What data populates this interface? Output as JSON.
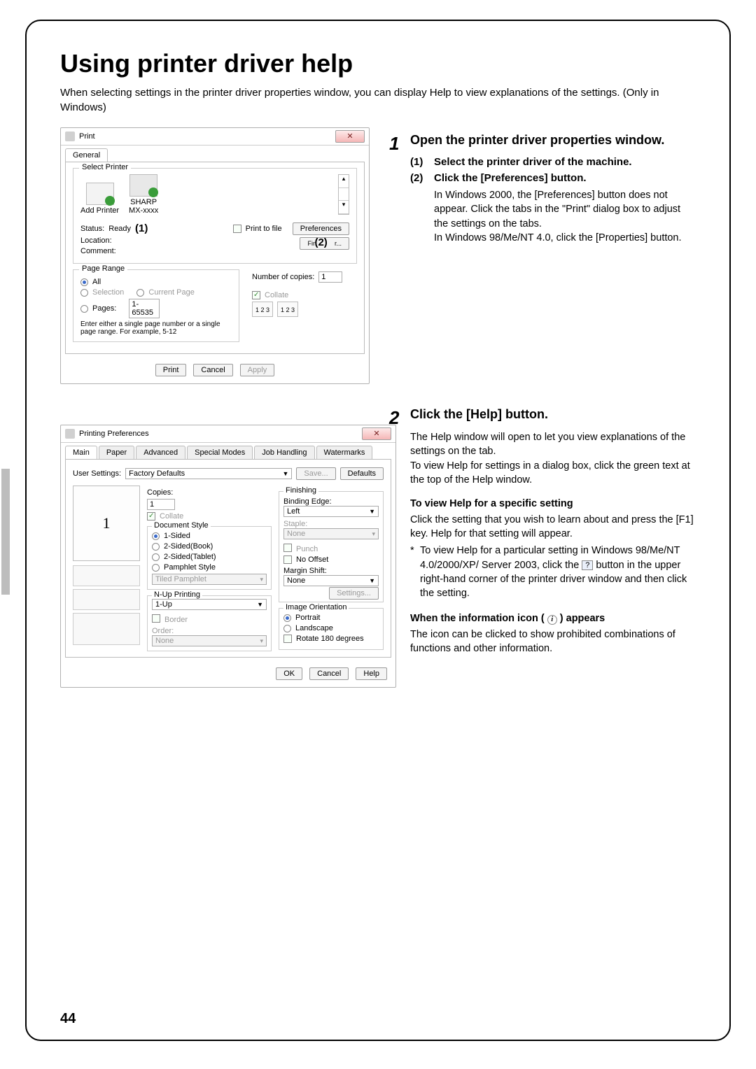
{
  "page": {
    "title": "Using printer driver help",
    "intro": "When selecting settings in the printer driver properties window, you can display Help to view explanations of the settings. (Only in Windows)",
    "page_number": "44"
  },
  "step1": {
    "num": "1",
    "heading": "Open the printer driver properties window.",
    "sub1_n": "(1)",
    "sub1_t": "Select the printer driver of the machine.",
    "sub2_n": "(2)",
    "sub2_t": "Click the [Preferences] button.",
    "detail": "In Windows 2000, the [Preferences] button does not appear. Click the tabs in the \"Print\" dialog box to adjust the settings on the tabs.\nIn Windows 98/Me/NT 4.0, click the [Properties] button."
  },
  "step2": {
    "num": "2",
    "heading": "Click the [Help] button.",
    "para1": "The Help window will open to let you view explanations of the settings on the tab.\nTo view Help for settings in a dialog box, click the green text at the top of the Help window.",
    "sub_heading": "To view Help for a specific setting",
    "para2": "Click the setting that you wish to learn about and press the [F1] key. Help for that setting will appear.",
    "bullet_mk": "*",
    "bullet_a": "To view Help for a particular setting in Windows 98/Me/NT 4.0/2000/XP/ Server 2003, click the ",
    "bullet_b": " button in the upper right-hand corner of the printer driver window and then click the setting.",
    "info_heading_a": "When the information icon ( ",
    "info_heading_b": " ) appears",
    "para3": "The icon can be clicked to show prohibited combinations of functions and other information."
  },
  "print_dialog": {
    "title": "Print",
    "tab": "General",
    "select_printer": "Select Printer",
    "add_printer": "Add Printer",
    "sharp": "SHARP",
    "model": "MX-xxxx",
    "status_lbl": "Status:",
    "status_val": "Ready",
    "callout1": "(1)",
    "location": "Location:",
    "comment": "Comment:",
    "print_to_file": "Print to file",
    "preferences": "Preferences",
    "find": "Find Printer...",
    "callout2": "(2)",
    "page_range": "Page Range",
    "all": "All",
    "selection": "Selection",
    "current": "Current Page",
    "pages": "Pages:",
    "pages_val": "1-65535",
    "hint": "Enter either a single page number or a single page range. For example, 5-12",
    "copies_lbl": "Number of copies:",
    "copies_val": "1",
    "collate": "Collate",
    "c123a": "1 2 3",
    "c123b": "1 2 3",
    "print": "Print",
    "cancel": "Cancel",
    "apply": "Apply"
  },
  "prefs": {
    "title": "Printing Preferences",
    "tabs": {
      "main": "Main",
      "paper": "Paper",
      "advanced": "Advanced",
      "special": "Special Modes",
      "job": "Job Handling",
      "water": "Watermarks"
    },
    "user_settings": "User Settings:",
    "factory_defaults": "Factory Defaults",
    "save": "Save...",
    "defaults": "Defaults",
    "preview_num": "1",
    "copies_lbl": "Copies:",
    "copies_val": "1",
    "collate": "Collate",
    "doc_style": "Document Style",
    "s1": "1-Sided",
    "s2": "2-Sided(Book)",
    "s3": "2-Sided(Tablet)",
    "s4": "Pamphlet Style",
    "tiled": "Tiled Pamphlet",
    "nup": "N-Up Printing",
    "nup_val": "1-Up",
    "border": "Border",
    "order_lbl": "Order:",
    "order_val": "None",
    "finishing": "Finishing",
    "binding_lbl": "Binding Edge:",
    "binding_val": "Left",
    "staple_lbl": "Staple:",
    "staple_val": "None",
    "punch": "Punch",
    "nooffset": "No Offset",
    "margin_lbl": "Margin Shift:",
    "margin_val": "None",
    "settings": "Settings...",
    "orient": "Image Orientation",
    "portrait": "Portrait",
    "landscape": "Landscape",
    "rotate": "Rotate 180 degrees",
    "ok": "OK",
    "cancel": "Cancel",
    "help": "Help"
  }
}
